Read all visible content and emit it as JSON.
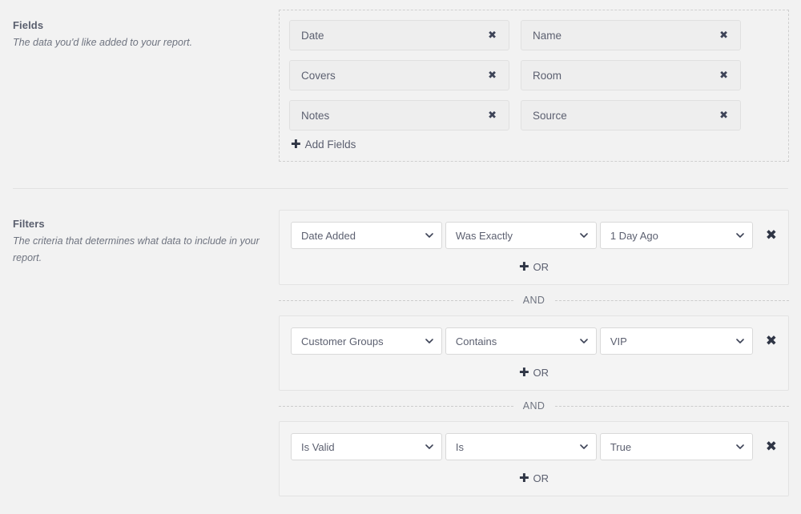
{
  "sections": {
    "fields": {
      "title": "Fields",
      "description": "The data you'd like added to your report.",
      "add_label": "Add Fields",
      "plus_icon": "plus-icon",
      "chips": [
        {
          "label": "Date",
          "remove_icon": "close-icon"
        },
        {
          "label": "Name",
          "remove_icon": "close-icon"
        },
        {
          "label": "Covers",
          "remove_icon": "close-icon"
        },
        {
          "label": "Room",
          "remove_icon": "close-icon"
        },
        {
          "label": "Notes",
          "remove_icon": "close-icon"
        },
        {
          "label": "Source",
          "remove_icon": "close-icon"
        }
      ]
    },
    "filters": {
      "title": "Filters",
      "description": "The criteria that determines what data to include in your report.",
      "conjunction_label": "AND",
      "or_label": "OR",
      "remove_icon": "close-icon",
      "chevron_icon": "chevron-down-icon",
      "rows": [
        {
          "field": "Date Added",
          "operator": "Was Exactly",
          "value": "1 Day Ago"
        },
        {
          "field": "Customer Groups",
          "operator": "Contains",
          "value": "VIP"
        },
        {
          "field": "Is Valid",
          "operator": "Is",
          "value": "True"
        }
      ]
    }
  },
  "colors": {
    "page_background": "#f2f2f2",
    "chip_background": "#eeeeee",
    "panel_background": "#f4f4f4",
    "text": "#5c6070",
    "heading": "#5a5f6e",
    "accent_dark": "#2f3545",
    "border": "#d9d9d9"
  }
}
